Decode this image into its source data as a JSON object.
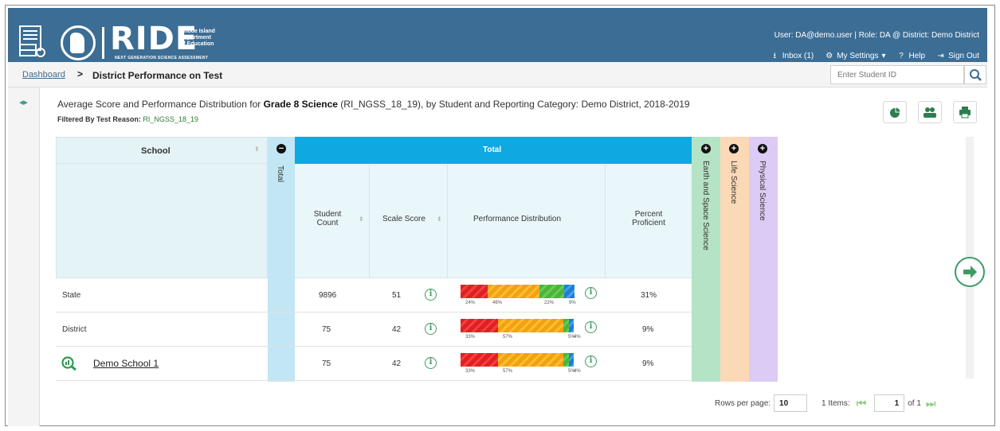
{
  "header": {
    "brand": "RIDE",
    "brand_sub_1": "Rhode Island",
    "brand_sub_2": "Department",
    "brand_sub_3": "of Education",
    "brand_tagline": "NEXT GENERATION SCIENCE ASSESSMENT",
    "user_line": "User: DA@demo.user  |  Role: DA @ District: Demo District",
    "inbox_label": "Inbox (1)",
    "settings_label": "My Settings",
    "help_label": "Help",
    "signout_label": "Sign Out"
  },
  "breadcrumb": {
    "link": "Dashboard",
    "separator": ">",
    "title": "District Performance on Test"
  },
  "search": {
    "placeholder": "Enter Student ID"
  },
  "report": {
    "title_pre": "Average Score and Performance Distribution for ",
    "title_bold": "Grade 8 Science",
    "title_post": " (RI_NGSS_18_19), by Student and Reporting Category: Demo District, 2018-2019",
    "filter_label": "Filtered By Test Reason:",
    "filter_value": "RI_NGSS_18_19"
  },
  "table": {
    "school_header": "School",
    "total_col_label": "Total",
    "total_banner": "Total",
    "col_student_count": "Student Count",
    "col_scale_score": "Scale Score",
    "col_perf_dist": "Performance Distribution",
    "col_percent_prof": "Percent Proficient",
    "categories": [
      "Earth and Space Science",
      "Life Science",
      "Physical Science"
    ],
    "rows": [
      {
        "name": "State",
        "count": "9896",
        "score": "51",
        "dist": [
          24,
          46,
          22,
          9
        ],
        "dist_labels": [
          "24%",
          "46%",
          "22%",
          "9%"
        ],
        "percent": "31%"
      },
      {
        "name": "District",
        "count": "75",
        "score": "42",
        "dist": [
          33,
          57,
          5,
          4
        ],
        "dist_labels": [
          "33%",
          "57%",
          "5%",
          "4%"
        ],
        "percent": "9%"
      },
      {
        "name": "Demo School 1",
        "count": "75",
        "score": "42",
        "dist": [
          33,
          57,
          5,
          4
        ],
        "dist_labels": [
          "33%",
          "57%",
          "5%",
          "4%"
        ],
        "percent": "9%"
      }
    ]
  },
  "pager": {
    "rows_label": "Rows per page:",
    "rows_value": "10",
    "items_label": "1 Items:",
    "page_value": "1",
    "of_label": "of 1"
  },
  "colors": {
    "header_bg": "#3c6d94",
    "total_banner": "#10a8e0",
    "total_col": "#c2e6f4",
    "earth_space": "#b5e3c5",
    "life_science": "#fcd9b6",
    "physical_science": "#dccbf5",
    "accent_green": "#3e9b62"
  }
}
